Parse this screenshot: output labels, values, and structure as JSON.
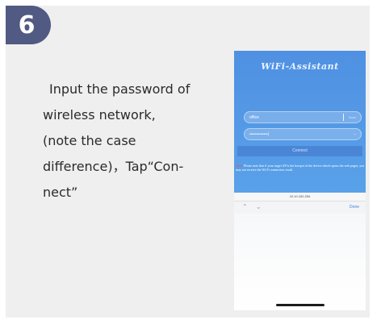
{
  "step": {
    "number": "6",
    "lines": [
      "Input the password of",
      "wireless network,",
      "(note the case",
      "difference)，Tap“Con-",
      "nect”"
    ]
  },
  "phone": {
    "app_title": "WiFi-Assistant",
    "ssid_field": {
      "value": "office",
      "action": "Scan"
    },
    "password_field": {
      "value": "•••••••••••••|",
      "action": "eye"
    },
    "connect_label": "Connect",
    "note_label": "Note:",
    "note_text": "Please note that if your target AP is the hotspot of the device which opens the web pages, you may not receive the Wi-Fi connection result.",
    "url": "10.10.100.254",
    "keyboard_bar": {
      "arrows": "⌃ ⌄",
      "done_label": "Done"
    }
  },
  "colors": {
    "badge": "#505a82",
    "app_blue": "#4f90e2",
    "card_bg": "#efefef",
    "note_label": "#ff4b4b"
  }
}
